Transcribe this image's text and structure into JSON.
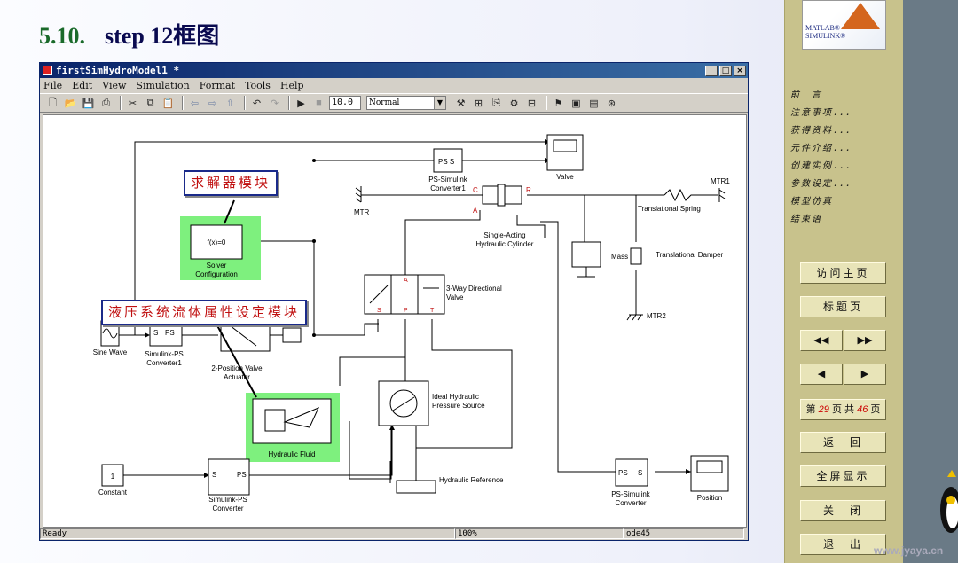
{
  "slide": {
    "number": "5.10.",
    "title": "step 12框图"
  },
  "window": {
    "title": "firstSimHydroModel1 *",
    "controls": [
      "_",
      "□",
      "×"
    ],
    "menu": [
      "File",
      "Edit",
      "View",
      "Simulation",
      "Format",
      "Tools",
      "Help"
    ],
    "stop_time": "10.0",
    "sim_mode": "Normal",
    "status": {
      "left": "Ready",
      "zoom": "100%",
      "solver": "ode45"
    }
  },
  "blocks": {
    "ps_simulink_1": "PS S",
    "ps_simulink_1_label": "PS-Simulink\nConverter1",
    "valve_scope": "Valve",
    "mtr": "MTR",
    "mtr1": "MTR1",
    "mtr2": "MTR2",
    "cyl_ports": {
      "c": "C",
      "r": "R",
      "a": "A"
    },
    "cylinder": "Single-Acting\nHydraulic Cylinder",
    "spring": "Translational Spring",
    "damper": "Translational Damper",
    "mass": "Mass",
    "solver": "f(x)=0",
    "solver_label": "Solver\nConfiguration",
    "dir_valve": "3-Way Directional\nValve",
    "valve_ports": {
      "a": "A",
      "s": "S",
      "p": "P",
      "t": "T"
    },
    "sine": "Sine Wave",
    "sps1_a": "S",
    "sps1_b": "PS",
    "sps1_label": "Simulink-PS\nConverter1",
    "actuator": "2-Position Valve\nActuator",
    "fluid": "Hydraulic Fluid",
    "pressure": "Ideal Hydraulic\nPressure Source",
    "ref": "Hydraulic Reference",
    "constant_value": "1",
    "constant": "Constant",
    "sps2_a": "S",
    "sps2_b": "PS",
    "sps2_label": "Simulink-PS\nConverter",
    "ps2_a": "PS",
    "ps2_b": "S",
    "ps2_label": "PS-Simulink\nConverter",
    "position": "Position"
  },
  "callouts": {
    "solver": "求解器模块",
    "fluid": "液压系统流体属性设定模块"
  },
  "sidebar": {
    "logo": [
      "MATLAB®",
      "SIMULINK®"
    ],
    "nav": [
      "前　言",
      "注意事项．．．",
      "获得资料．．．",
      "元件介绍．．．",
      "创建实例．．．",
      "参数设定．．．",
      "模型仿真",
      "结束语"
    ],
    "buttons": {
      "home": "访问主页",
      "title": "标题页",
      "first": "◀◀",
      "last": "▶▶",
      "prev": "◀",
      "next": "▶",
      "back": "返　回",
      "full": "全屏显示",
      "close": "关　闭",
      "exit": "退　出"
    },
    "page": {
      "pre": "第 ",
      "cur": "29",
      "mid": " 页 共 ",
      "total": "46",
      "post": " 页"
    }
  },
  "watermark": "www.jyaya.cn",
  "colors": {
    "highlight": "#7ef07e",
    "accent": "#c01010",
    "sidebar": "#c8c28c"
  }
}
